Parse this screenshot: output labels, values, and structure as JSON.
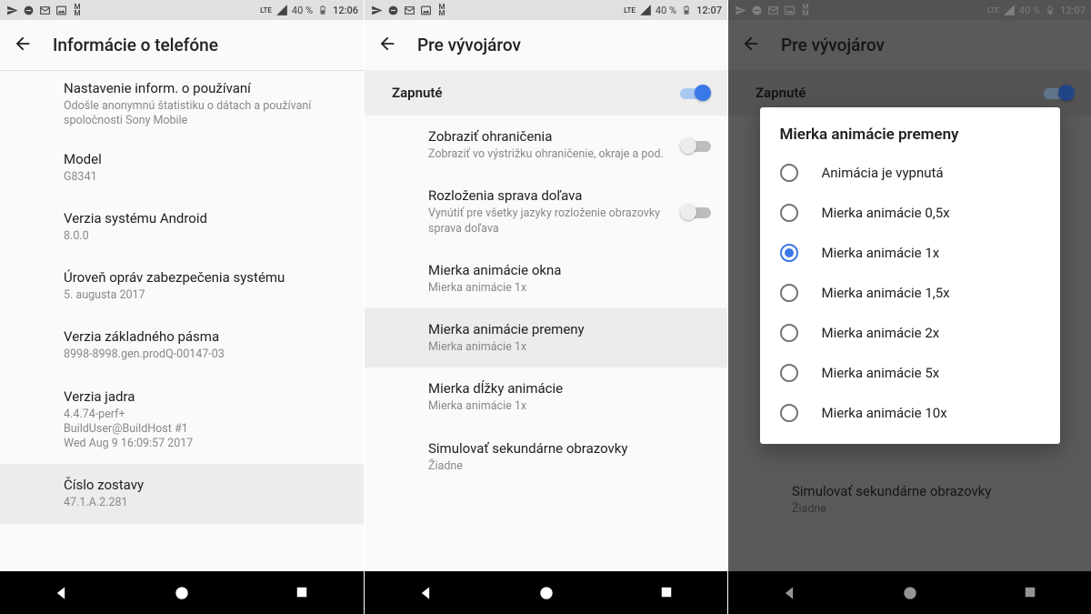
{
  "status": {
    "lte": "LTE",
    "battery": "40 %",
    "time1": "12:06",
    "time2": "12:07",
    "time3": "12:07"
  },
  "screen1": {
    "title": "Informácie o telefóne",
    "items": [
      {
        "title": "Nastavenie inform. o používaní",
        "sub": "Odošle anonymnú štatistiku o dátach a používaní spoločnosti Sony Mobile"
      },
      {
        "title": "Model",
        "sub": "G8341"
      },
      {
        "title": "Verzia systému Android",
        "sub": "8.0.0"
      },
      {
        "title": "Úroveň opráv zabezpečenia systému",
        "sub": "5. augusta 2017"
      },
      {
        "title": "Verzia základného pásma",
        "sub": "8998-8998.gen.prodQ-00147-03"
      },
      {
        "title": "Verzia jadra",
        "sub": "4.4.74-perf+\nBuildUser@BuildHost #1\nWed Aug 9 16:09:57 2017"
      },
      {
        "title": "Číslo zostavy",
        "sub": "47.1.A.2.281"
      }
    ]
  },
  "screen2": {
    "title": "Pre vývojárov",
    "master_label": "Zapnuté",
    "items": [
      {
        "title": "Zobraziť ohraničenia",
        "sub": "Zobraziť vo výstrižku ohraničenie, okraje a pod.",
        "switch": "off"
      },
      {
        "title": "Rozloženia sprava doľava",
        "sub": "Vynútiť pre všetky jazyky rozloženie obrazovky sprava doľava",
        "switch": "off"
      },
      {
        "title": "Mierka animácie okna",
        "sub": "Mierka animácie 1x"
      },
      {
        "title": "Mierka animácie premeny",
        "sub": "Mierka animácie 1x",
        "selected": true
      },
      {
        "title": "Mierka dĺžky animácie",
        "sub": "Mierka animácie 1x"
      },
      {
        "title": "Simulovať sekundárne obrazovky",
        "sub": "Žiadne"
      }
    ]
  },
  "screen3": {
    "title": "Pre vývojárov",
    "master_label": "Zapnuté",
    "bg_item_title": "Simulovať sekundárne obrazovky",
    "bg_item_sub": "Žiadne",
    "dialog": {
      "title": "Mierka animácie premeny",
      "options": [
        "Animácia je vypnutá",
        "Mierka animácie 0,5x",
        "Mierka animácie 1x",
        "Mierka animácie 1,5x",
        "Mierka animácie 2x",
        "Mierka animácie 5x",
        "Mierka animácie 10x"
      ],
      "selected_index": 2
    }
  }
}
